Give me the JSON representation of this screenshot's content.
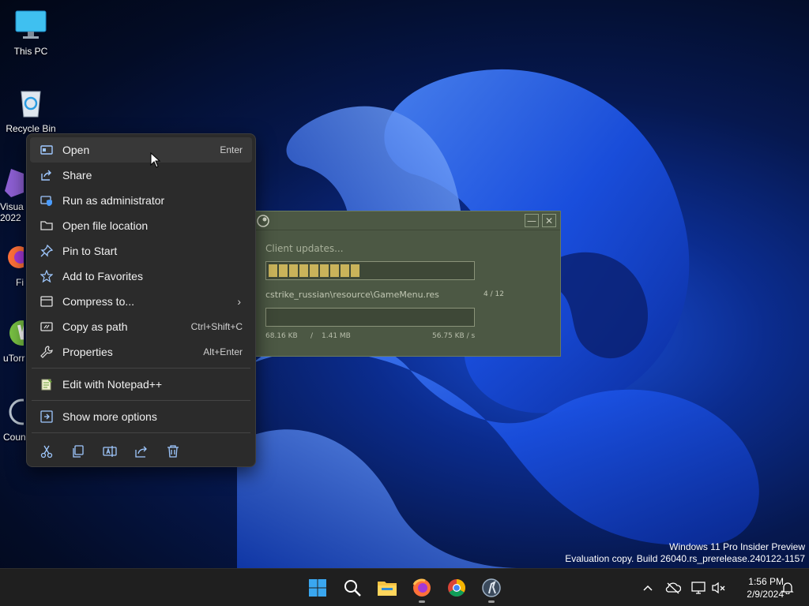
{
  "desktop": {
    "icons": [
      {
        "label": "This PC"
      },
      {
        "label": "Recycle Bin"
      }
    ],
    "partial_icons": [
      {
        "label": "Visua\n2022"
      },
      {
        "label": "Fi"
      },
      {
        "label": "uTorr"
      },
      {
        "label": "Coun"
      }
    ]
  },
  "context_menu": {
    "items": [
      {
        "label": "Open",
        "shortcut": "Enter",
        "icon": "open-icon"
      },
      {
        "label": "Share",
        "shortcut": "",
        "icon": "share-icon"
      },
      {
        "label": "Run as administrator",
        "shortcut": "",
        "icon": "shield-icon"
      },
      {
        "label": "Open file location",
        "shortcut": "",
        "icon": "folder-icon"
      },
      {
        "label": "Pin to Start",
        "shortcut": "",
        "icon": "pin-icon"
      },
      {
        "label": "Add to Favorites",
        "shortcut": "",
        "icon": "star-icon"
      },
      {
        "label": "Compress to...",
        "shortcut": "",
        "icon": "archive-icon"
      },
      {
        "label": "Copy as path",
        "shortcut": "Ctrl+Shift+C",
        "icon": "path-icon"
      },
      {
        "label": "Properties",
        "shortcut": "Alt+Enter",
        "icon": "wrench-icon"
      }
    ],
    "extra": {
      "label": "Edit with Notepad++",
      "icon": "notepad-icon"
    },
    "more": {
      "label": "Show more options",
      "icon": "more-options-icon"
    },
    "actions": [
      "cut-icon",
      "copy-icon",
      "rename-icon",
      "share-icon",
      "delete-icon"
    ]
  },
  "updater": {
    "status": "Client updates...",
    "progress_segments": 9,
    "file": "cstrike_russian\\resource\\GameMenu.res",
    "count": "4 / 12",
    "downloaded": "68.16 KB",
    "separator": "/",
    "total": "1.41 MB",
    "speed": "56.75 KB / s",
    "minimize_symbol": "—",
    "close_symbol": "✕"
  },
  "watermark": {
    "line1": "Windows 11 Pro Insider Preview",
    "line2": "Evaluation copy. Build 26040.rs_prerelease.240122-1157"
  },
  "taskbar": {
    "apps": [
      "start-icon",
      "search-icon",
      "file-explorer-icon",
      "firefox-icon",
      "chrome-icon",
      "counter-strike-icon"
    ],
    "tray": [
      "chevron-up-icon",
      "network-offline-icon",
      "display-icon",
      "volume-muted-icon",
      "notification-bell-icon"
    ],
    "time": "1:56 PM",
    "date": "2/9/2024"
  },
  "colors": {
    "menu_bg": "#2b2b2b",
    "updater_bg": "#4c5844",
    "progress": "#c9b35a",
    "taskbar": "#1f1f1f"
  }
}
